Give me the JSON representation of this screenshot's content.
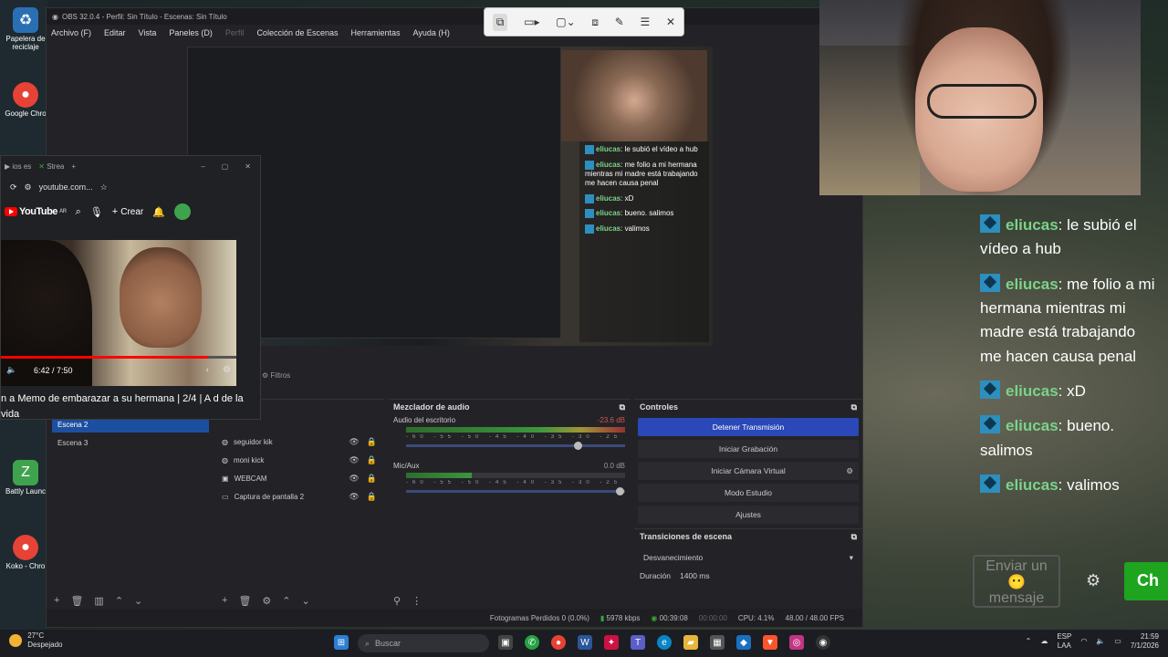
{
  "desktop_icons": [
    {
      "label": "Papelera de reciclaje",
      "icon": "recycle-bin-icon",
      "color": "#2a6fb3"
    },
    {
      "label": "Google Chro",
      "icon": "chrome-icon",
      "color": "#e64235"
    },
    {
      "label": "Battly Launc",
      "icon": "battly-launcher-icon",
      "color": "#3fa34d"
    },
    {
      "label": "Koko - Chro",
      "icon": "chrome-icon",
      "color": "#e64235"
    }
  ],
  "obs": {
    "window_title": "OBS 32.0.4 - Perfil: Sin Título - Escenas: Sin Título",
    "menu": [
      "Archivo (F)",
      "Editar",
      "Vista",
      "Paneles (D)",
      "Perfil",
      "Colección de Escenas",
      "Herramientas",
      "Ayuda (H)"
    ],
    "filters_label": "Filtros",
    "scenes": [
      {
        "name": "Escena 2",
        "active": true
      },
      {
        "name": "Escena 3",
        "active": false
      }
    ],
    "sources": [
      {
        "name": "seguidor kik",
        "icon": "image-icon"
      },
      {
        "name": "moni kick",
        "icon": "browser-source-icon"
      },
      {
        "name": "WEBCAM",
        "icon": "camera-icon"
      },
      {
        "name": "Captura de pantalla 2",
        "icon": "display-capture-icon"
      }
    ],
    "mixer": {
      "title": "Mezclador de audio",
      "tracks": [
        {
          "name": "Audio del escritorio",
          "db": "-23.6 dB",
          "level": 0.82,
          "volume": 0.8
        },
        {
          "name": "Mic/Aux",
          "db": "0.0 dB",
          "level": 0.32,
          "volume": 1.0
        }
      ],
      "scale": "-60 -55 -50 -45 -40 -35 -30 -25 -20 -15 -10 -5 0"
    },
    "controls": {
      "title": "Controles",
      "buttons": [
        "Detener Transmisión",
        "Iniciar Grabación",
        "Iniciar Cámara Virtual",
        "Modo Estudio",
        "Ajustes"
      ]
    },
    "transitions": {
      "title": "Transiciones de escena",
      "selected": "Desvanecimiento",
      "duration_label": "Duración",
      "duration_value": "1400 ms"
    },
    "status": {
      "dropped": "Fotogramas Perdidos 0 (0.0%)",
      "bitrate": "5978 kbps",
      "stream_time": "00:39:08",
      "rec_time": "00:00:00",
      "cpu": "CPU: 4.1%",
      "fps": "48.00 / 48.00 FPS"
    }
  },
  "browser": {
    "tabs": [
      "ios es",
      "Strea"
    ],
    "url": "youtube.com...",
    "create_label": "Crear",
    "logo_text": "YouTube",
    "logo_region": "AR",
    "video_time": "6:42 / 7:50",
    "video_progress": 0.88,
    "video_title": "n a Memo de embarazar a su hermana | 2/4 | A d de la vida"
  },
  "chat": {
    "messages": [
      {
        "user": "eliucas",
        "text": "le subió el vídeo a hub"
      },
      {
        "user": "eliucas",
        "text": "me folio a mi hermana mientras mi madre está trabajando me hacen causa penal"
      },
      {
        "user": "eliucas",
        "text": "xD"
      },
      {
        "user": "eliucas",
        "text": "bueno. salimos"
      },
      {
        "user": "eliucas",
        "text": "valimos"
      }
    ],
    "input_placeholder": "Enviar un 😶 mensaje",
    "send_label": "Ch"
  },
  "taskbar": {
    "weather_temp": "27°C",
    "weather_desc": "Despejado",
    "search_placeholder": "Buscar",
    "lang_top": "ESP",
    "lang_bottom": "LAA",
    "time": "21:59",
    "date": "7/1/2026"
  }
}
